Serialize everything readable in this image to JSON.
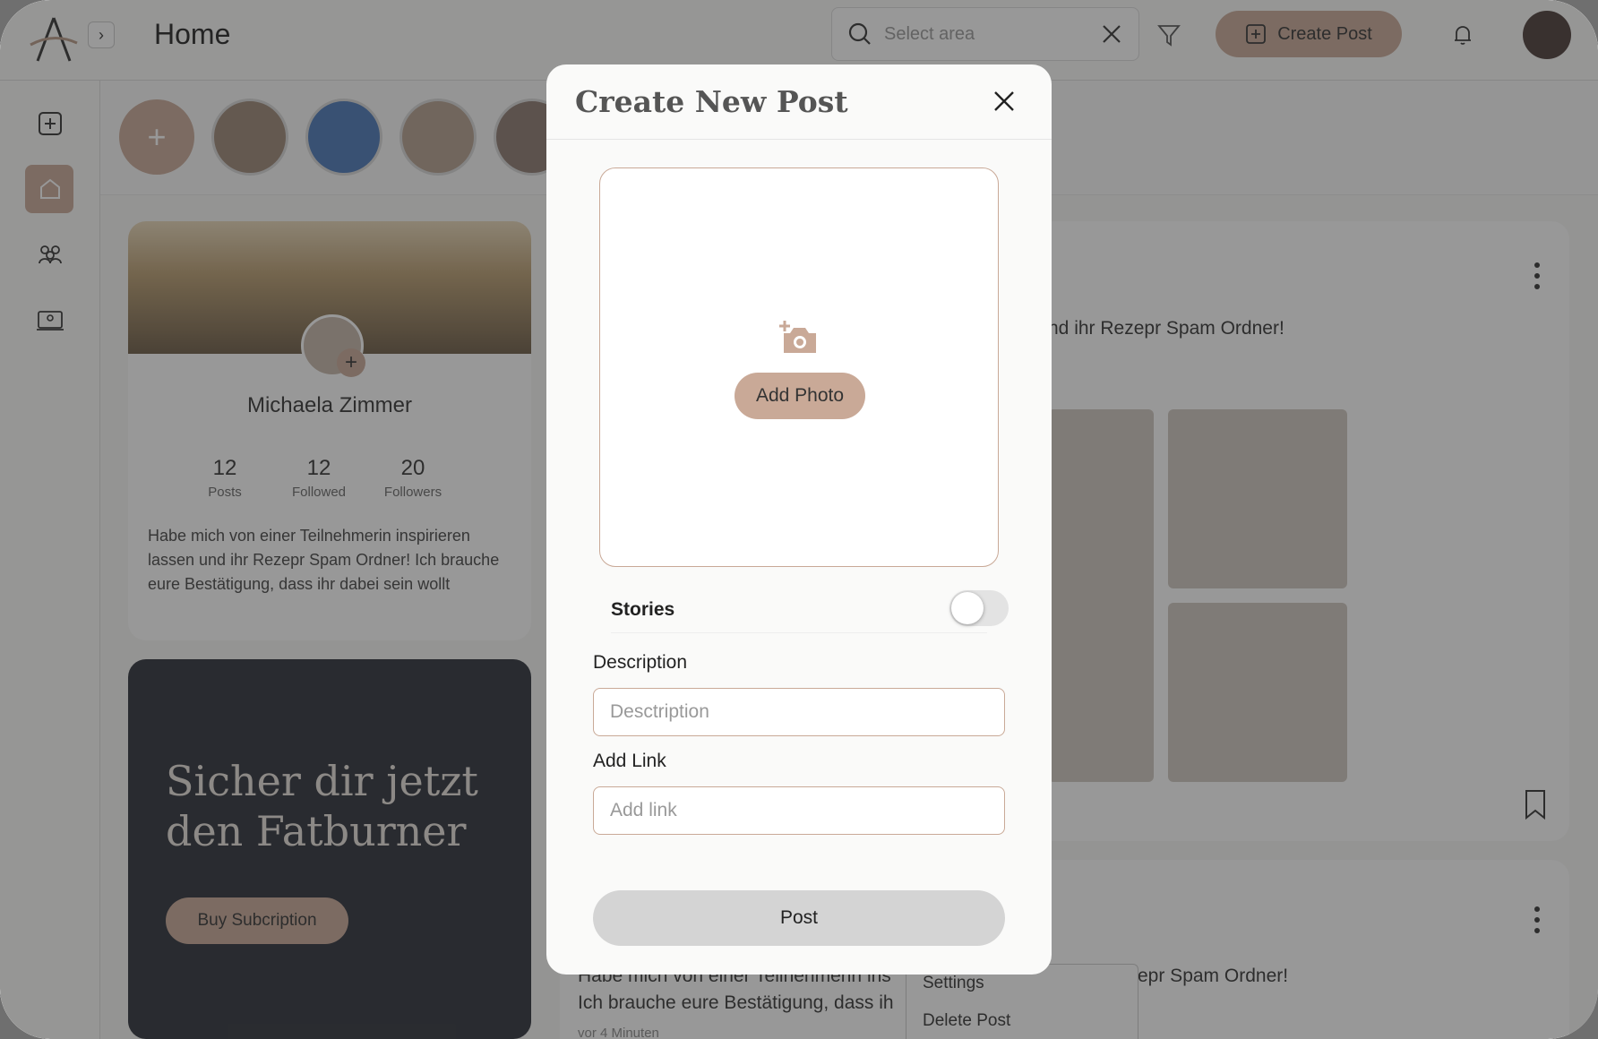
{
  "header": {
    "title": "Home",
    "search_placeholder": "Select area",
    "create_post_label": "Create Post"
  },
  "sidebar": {
    "items": [
      {
        "icon": "add-square-icon"
      },
      {
        "icon": "home-icon",
        "active": true
      },
      {
        "icon": "community-icon"
      },
      {
        "icon": "courses-icon"
      }
    ]
  },
  "stories": {
    "add_label": "+"
  },
  "profile": {
    "name": "Michaela Zimmer",
    "stats": [
      {
        "value": "12",
        "label": "Posts"
      },
      {
        "value": "12",
        "label": "Followed"
      },
      {
        "value": "20",
        "label": "Followers"
      }
    ],
    "bio": "Habe mich von einer Teilnehmerin inspirieren lassen und ihr Rezepr Spam Ordner! Ich brauche eure Bestätigung, dass ihr dabei sein wollt"
  },
  "promo": {
    "title": "Sicher dir jetzt den Fatburner",
    "button_label": "Buy Subcription"
  },
  "feed": {
    "post1_text_fragment": "nd ihr Rezepr Spam Ordner!",
    "post2_text_right": "epr Spam Ordner!",
    "post2_line1": "Habe mich von einer Teilnehmerin ins",
    "post2_line2": "Ich brauche eure Bestätigung, dass ih",
    "post2_time": "vor 4 Minuten",
    "menu": [
      "Settings",
      "Delete Post"
    ]
  },
  "modal": {
    "title": "Create New Post",
    "add_photo_label": "Add Photo",
    "stories_label": "Stories",
    "stories_on": false,
    "description_label": "Description",
    "description_placeholder": "Desctription",
    "link_label": "Add Link",
    "link_placeholder": "Add link",
    "post_label": "Post"
  },
  "colors": {
    "accent": "#c9a997",
    "overlay": "rgba(40,40,40,0.48)"
  }
}
